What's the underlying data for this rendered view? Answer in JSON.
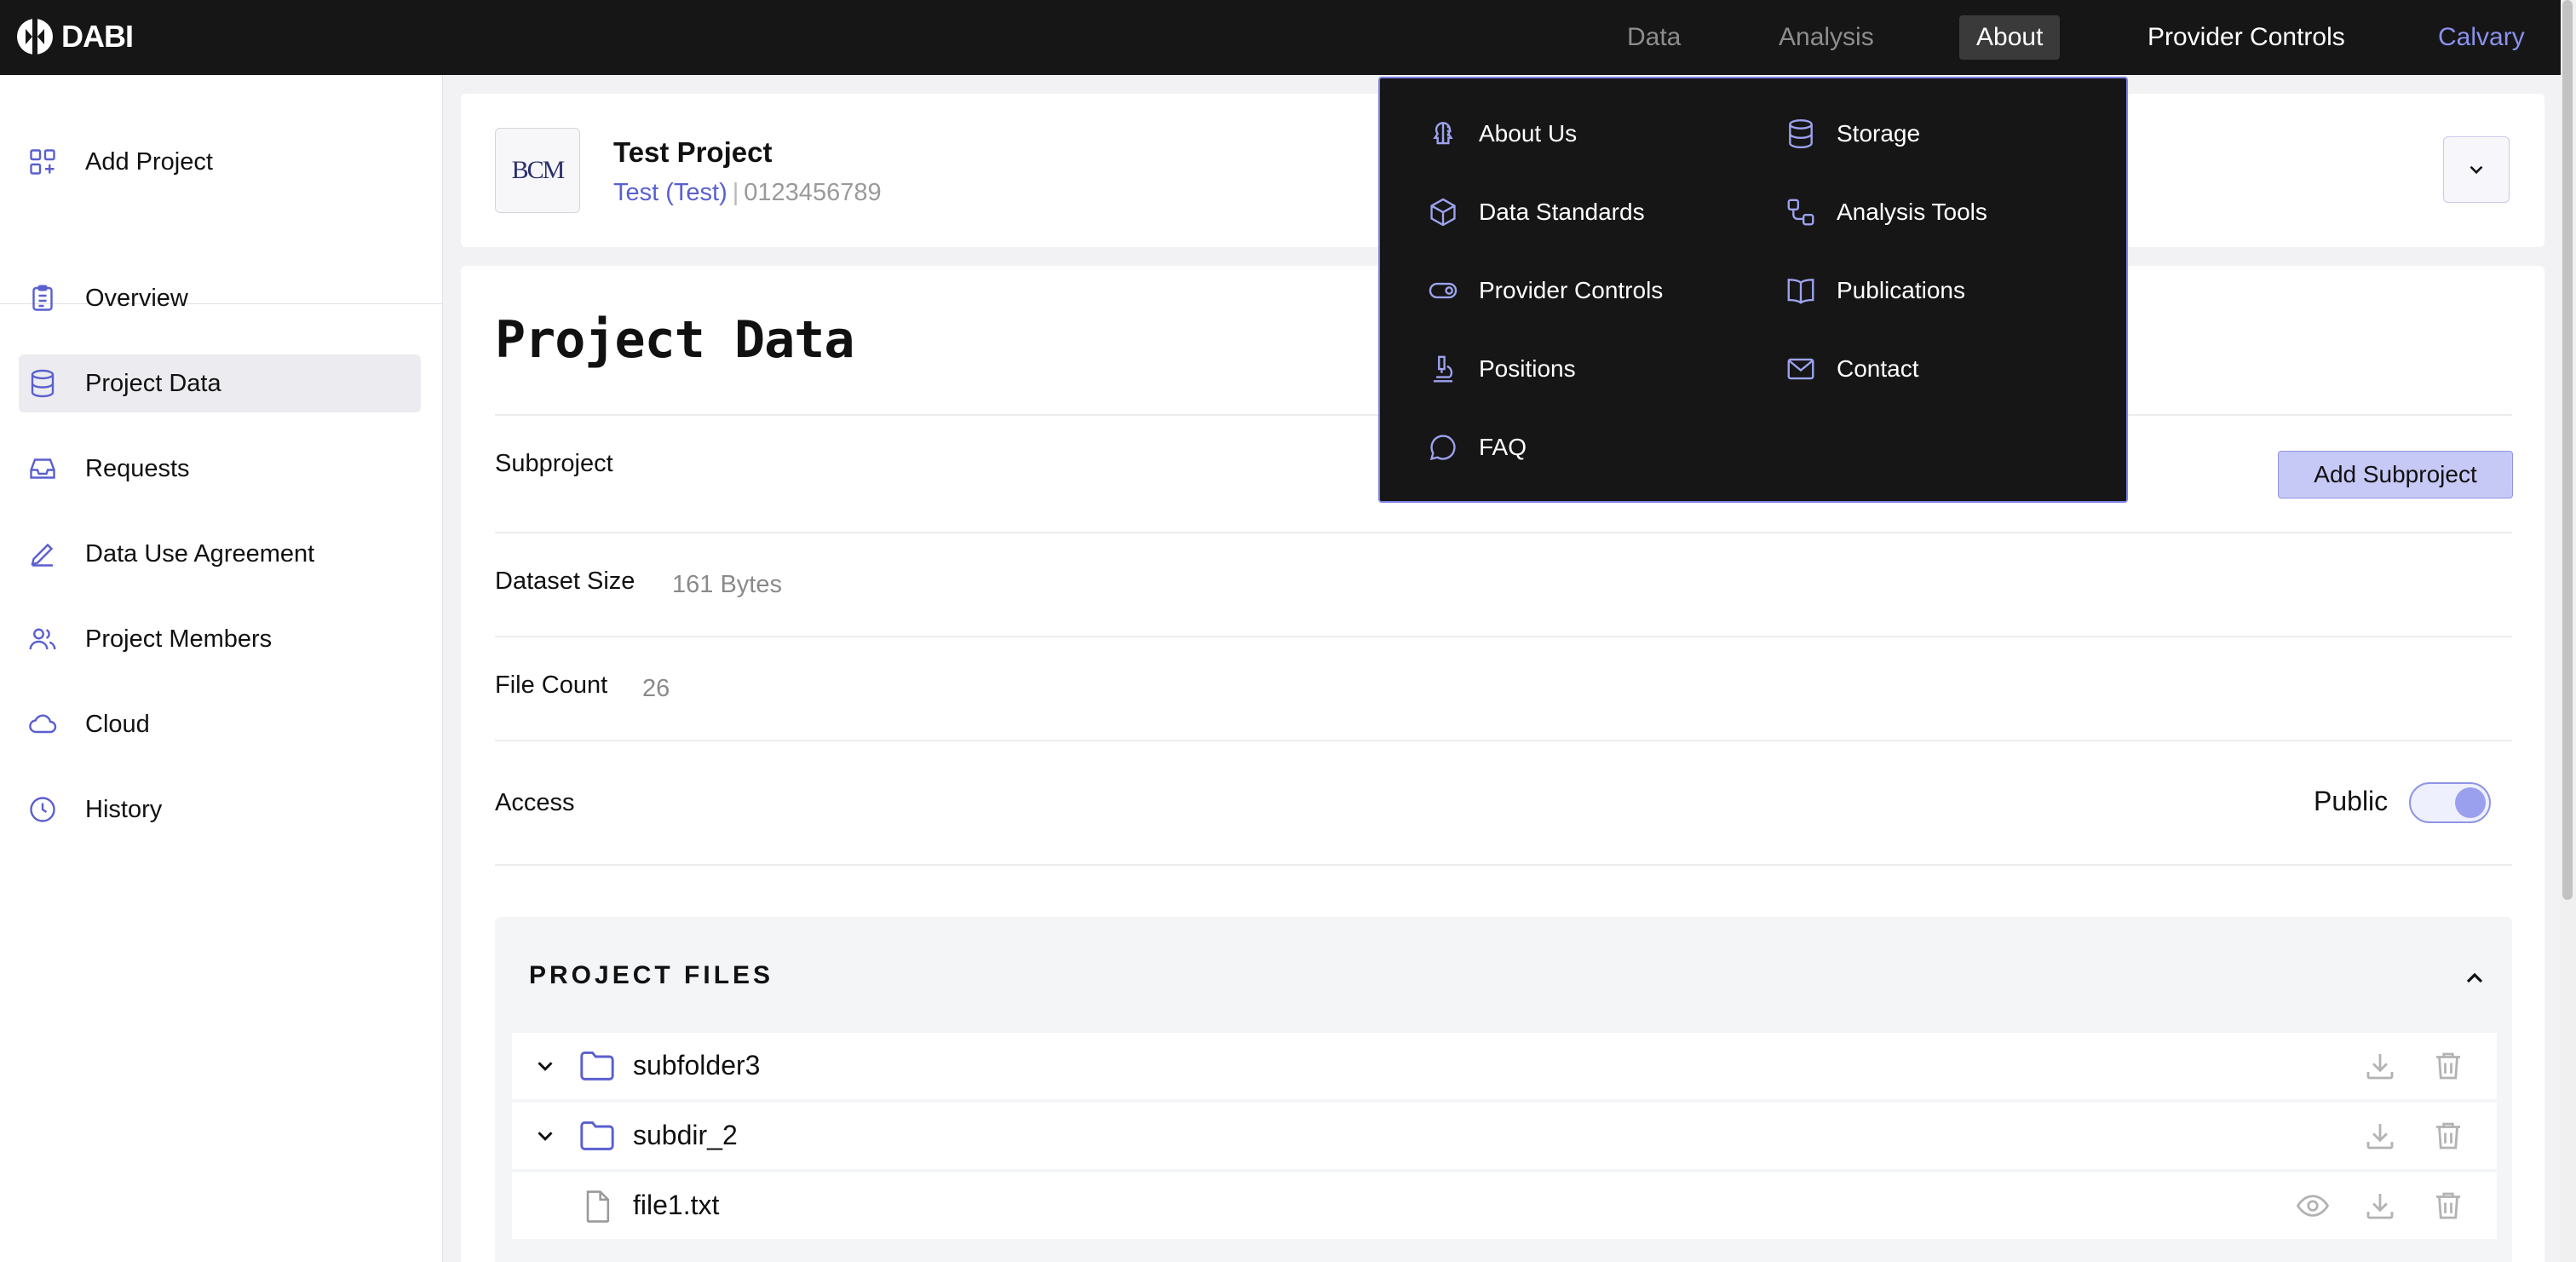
{
  "brand": {
    "name": "DABI"
  },
  "nav": {
    "items": [
      {
        "label": "Data"
      },
      {
        "label": "Analysis"
      },
      {
        "label": "About"
      },
      {
        "label": "Provider Controls"
      },
      {
        "label": "Calvary"
      }
    ]
  },
  "about_menu": {
    "items": [
      {
        "label": "About Us",
        "icon": "brain-icon"
      },
      {
        "label": "Storage",
        "icon": "database-icon"
      },
      {
        "label": "Data Standards",
        "icon": "cube-icon"
      },
      {
        "label": "Analysis Tools",
        "icon": "workflow-icon"
      },
      {
        "label": "Provider Controls",
        "icon": "toggle-icon"
      },
      {
        "label": "Publications",
        "icon": "book-open-icon"
      },
      {
        "label": "Positions",
        "icon": "microscope-icon"
      },
      {
        "label": "Contact",
        "icon": "mail-icon"
      },
      {
        "label": "FAQ",
        "icon": "chat-bubble-icon"
      }
    ]
  },
  "sidebar": {
    "add_project": "Add Project",
    "items": [
      {
        "label": "Overview",
        "icon": "clipboard-list-icon"
      },
      {
        "label": "Project Data",
        "icon": "database-icon",
        "active": true
      },
      {
        "label": "Requests",
        "icon": "inbox-icon"
      },
      {
        "label": "Data Use Agreement",
        "icon": "pen-icon"
      },
      {
        "label": "Project Members",
        "icon": "users-icon"
      },
      {
        "label": "Cloud",
        "icon": "cloud-icon"
      },
      {
        "label": "History",
        "icon": "clock-icon"
      }
    ]
  },
  "project": {
    "logo_text": "BCM",
    "title": "Test Project",
    "owner": "Test (Test)",
    "separator": "|",
    "id": "0123456789"
  },
  "page": {
    "title": "Project Data",
    "subproject_label": "Subproject",
    "add_subproject": "Add Subproject",
    "dataset_size_label": "Dataset Size",
    "dataset_size_value": "161 Bytes",
    "file_count_label": "File Count",
    "file_count_value": "26",
    "access_label": "Access",
    "access_value": "Public",
    "access_public": true
  },
  "files": {
    "title": "PROJECT FILES",
    "rows": [
      {
        "name": "subfolder3",
        "type": "folder"
      },
      {
        "name": "subdir_2",
        "type": "folder"
      },
      {
        "name": "file1.txt",
        "type": "file"
      }
    ]
  },
  "colors": {
    "accent": "#5a5fd0",
    "topbar": "#161616",
    "button": "#c6c9f6"
  }
}
